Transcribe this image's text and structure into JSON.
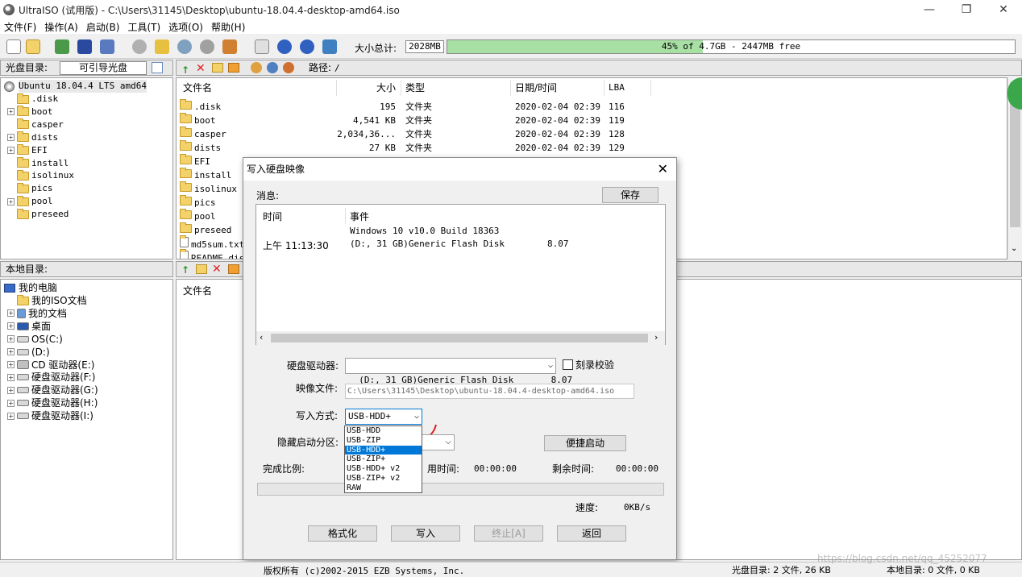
{
  "window": {
    "title": "UltraISO (试用版) - C:\\Users\\31145\\Desktop\\ubuntu-18.04.4-desktop-amd64.iso",
    "minimize": "—",
    "maximize": "❐",
    "close": "✕"
  },
  "menu": [
    "文件(F)",
    "操作(A)",
    "启动(B)",
    "工具(T)",
    "选项(O)",
    "帮助(H)"
  ],
  "toolbar": {
    "size_label": "大小总计:",
    "size_value": "2028MB",
    "capacity_text": "45% of 4.7GB - 2447MB free",
    "capacity_fraction": 0.45
  },
  "disc_header": {
    "label": "光盘目录:",
    "boot_button": "可引导光盘",
    "path_label": "路径:",
    "path_value": "/"
  },
  "disc_tree": {
    "root": "Ubuntu 18.04.4 LTS amd64",
    "items": [
      {
        "name": ".disk",
        "expandable": false
      },
      {
        "name": "boot",
        "expandable": true
      },
      {
        "name": "casper",
        "expandable": false
      },
      {
        "name": "dists",
        "expandable": true
      },
      {
        "name": "EFI",
        "expandable": true
      },
      {
        "name": "install",
        "expandable": false
      },
      {
        "name": "isolinux",
        "expandable": false
      },
      {
        "name": "pics",
        "expandable": false
      },
      {
        "name": "pool",
        "expandable": true
      },
      {
        "name": "preseed",
        "expandable": false
      }
    ]
  },
  "disc_files": {
    "columns": {
      "name": "文件名",
      "size": "大小",
      "type": "类型",
      "date": "日期/时间",
      "lba": "LBA"
    },
    "rows": [
      {
        "name": ".disk",
        "size": "195",
        "type": "文件夹",
        "date": "2020-02-04 02:39",
        "lba": "116"
      },
      {
        "name": "boot",
        "size": "4,541 KB",
        "type": "文件夹",
        "date": "2020-02-04 02:39",
        "lba": "119"
      },
      {
        "name": "casper",
        "size": "2,034,36...",
        "type": "文件夹",
        "date": "2020-02-04 02:39",
        "lba": "128"
      },
      {
        "name": "dists",
        "size": "27 KB",
        "type": "文件夹",
        "date": "2020-02-04 02:39",
        "lba": "129"
      },
      {
        "name": "EFI",
        "size": "",
        "type": "",
        "date": "",
        "lba": ""
      },
      {
        "name": "install",
        "size": "",
        "type": "",
        "date": "",
        "lba": ""
      },
      {
        "name": "isolinux",
        "size": "",
        "type": "",
        "date": "",
        "lba": ""
      },
      {
        "name": "pics",
        "size": "",
        "type": "",
        "date": "",
        "lba": ""
      },
      {
        "name": "pool",
        "size": "",
        "type": "",
        "date": "",
        "lba": ""
      },
      {
        "name": "preseed",
        "size": "",
        "type": "",
        "date": "",
        "lba": ""
      },
      {
        "name": "md5sum.txt",
        "size": "",
        "type": "",
        "date": "",
        "lba": ""
      },
      {
        "name": "README.dis",
        "size": "",
        "type": "",
        "date": "",
        "lba": ""
      }
    ]
  },
  "local_header": {
    "label": "本地目录:"
  },
  "local_tree": {
    "root": "我的电脑",
    "items": [
      {
        "name": "我的ISO文档",
        "kind": "folder",
        "expandable": false
      },
      {
        "name": "我的文档",
        "kind": "doc",
        "expandable": true
      },
      {
        "name": "桌面",
        "kind": "desktop",
        "expandable": true
      },
      {
        "name": "OS(C:)",
        "kind": "drive",
        "expandable": true
      },
      {
        "name": "(D:)",
        "kind": "drive",
        "expandable": true
      },
      {
        "name": "CD 驱动器(E:)",
        "kind": "cd",
        "expandable": true
      },
      {
        "name": "硬盘驱动器(F:)",
        "kind": "drive",
        "expandable": true
      },
      {
        "name": "硬盘驱动器(G:)",
        "kind": "drive",
        "expandable": true
      },
      {
        "name": "硬盘驱动器(H:)",
        "kind": "drive",
        "expandable": true
      },
      {
        "name": "硬盘驱动器(I:)",
        "kind": "drive",
        "expandable": true
      }
    ]
  },
  "local_files": {
    "col_name": "文件名"
  },
  "dialog": {
    "title": "写入硬盘映像",
    "messages_label": "消息:",
    "save_button": "保存",
    "log_col_time": "时间",
    "log_col_event": "事件",
    "log": [
      {
        "time": "",
        "event": "Windows 10 v10.0 Build 18363"
      },
      {
        "time": "上午 11:13:30",
        "event": "(D:, 31 GB)Generic Flash Disk        8.07"
      }
    ],
    "drive_label": "硬盘驱动器:",
    "drive_value": "(D:, 31 GB)Generic Flash Disk       8.07",
    "verify_label": "刻录校验",
    "image_label": "映像文件:",
    "image_value": "C:\\Users\\31145\\Desktop\\ubuntu-18.04.4-desktop-amd64.iso",
    "method_label": "写入方式:",
    "method_value": "USB-HDD+",
    "method_options": [
      "USB-HDD",
      "USB-ZIP",
      "USB-HDD+",
      "USB-ZIP+",
      "USB-HDD+ v2",
      "USB-ZIP+ v2",
      "RAW"
    ],
    "method_selected_index": 2,
    "hide_label": "隐藏启动分区:",
    "quick_boot_button": "便捷启动",
    "progress_label": "完成比例:",
    "elapsed_label": "用时间:",
    "elapsed_value": "00:00:00",
    "remaining_label": "剩余时间:",
    "remaining_value": "00:00:00",
    "speed_label": "速度:",
    "speed_value": "0KB/s",
    "format_button": "格式化",
    "write_button": "写入",
    "stop_button": "终止[A]",
    "back_button": "返回"
  },
  "statusbar": {
    "copyright": "版权所有 (c)2002-2015 EZB Systems, Inc.",
    "disc_status": "光盘目录: 2 文件, 26 KB",
    "local_status": "本地目录: 0 文件, 0 KB",
    "watermark": "https://blog.csdn.net/qq_45252077"
  },
  "colors": {
    "accent": "#0078d7",
    "capacity_fill": "#a8e0a4",
    "folder": "#f4d26a",
    "annotation_arrow": "#e02020"
  }
}
